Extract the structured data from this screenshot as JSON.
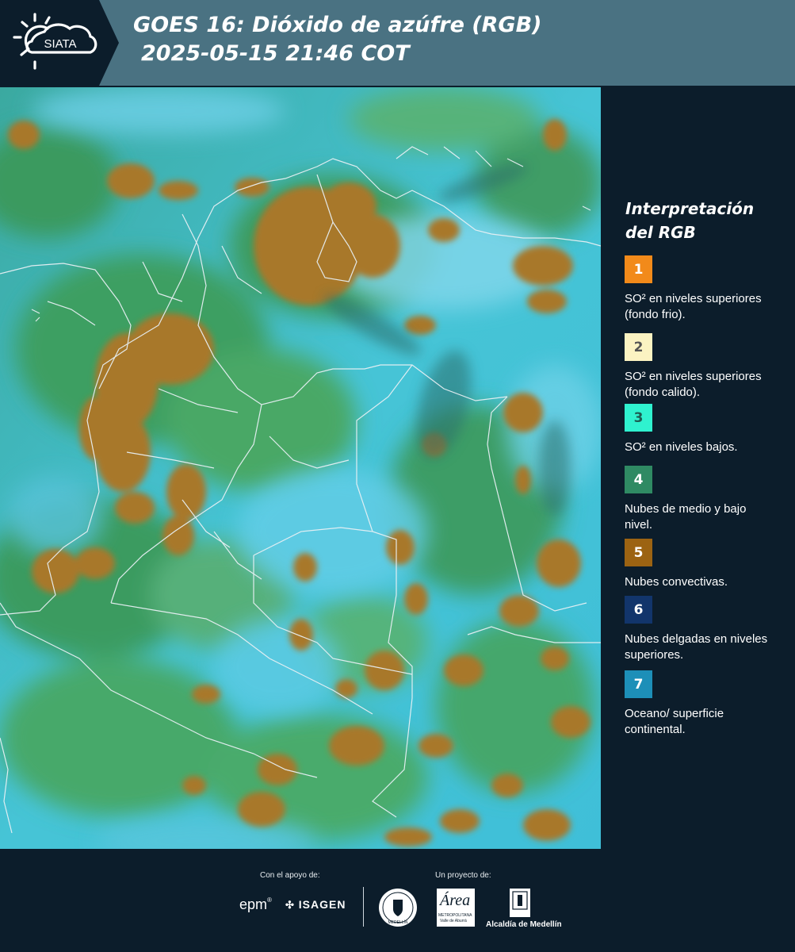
{
  "header": {
    "logo_text": "SIATA",
    "title_line1": "GOES 16: Dióxido de azúfre (RGB)",
    "title_line2": "2025-05-15 21:46 COT"
  },
  "legend": {
    "title": "Interpretación del RGB",
    "items": [
      {
        "number": "1",
        "color": "#f28a1a",
        "text_color": "#ffffff",
        "description": "SO² en niveles superiores (fondo frio)."
      },
      {
        "number": "2",
        "color": "#fbf3c2",
        "text_color": "#555555",
        "description": "SO² en niveles superiores (fondo calido)."
      },
      {
        "number": "3",
        "color": "#2ff2cf",
        "text_color": "#1d5c52",
        "description": "SO² en niveles bajos."
      },
      {
        "number": "4",
        "color": "#2f8a63",
        "text_color": "#ffffff",
        "description": "Nubes de medio y bajo nivel."
      },
      {
        "number": "5",
        "color": "#9c6312",
        "text_color": "#ffffff",
        "description": "Nubes convectivas."
      },
      {
        "number": "6",
        "color": "#12356b",
        "text_color": "#ffffff",
        "description": "Nubes delgadas en niveles superiores."
      },
      {
        "number": "7",
        "color": "#1d8fb8",
        "text_color": "#ffffff",
        "description": "Oceano/ superficie continental."
      }
    ]
  },
  "footer": {
    "support_label": "Con el apoyo de:",
    "project_label": "Un proyecto de:",
    "sponsor_epm": "epm",
    "sponsor_isagen": "ISAGEN",
    "area_metropolitana_name": "Área",
    "area_metropolitana_sub": "METROPOLITANA",
    "area_metropolitana_sub2": "Valle de Aburrá",
    "alcaldia_label": "Alcaldía de Medellín",
    "seal_text": "MEDELLÍN"
  },
  "map": {
    "ocean_color": "#3fc0dc",
    "land_color": "#3aa36a",
    "convective_color": "#a8782a",
    "border_color": "#e8f0f4"
  }
}
